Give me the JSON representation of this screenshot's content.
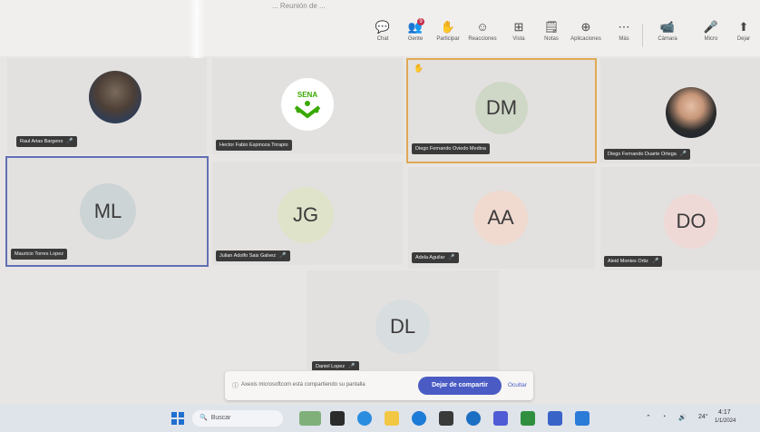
{
  "window": {
    "title_text": "... Reunión de ... "
  },
  "toolbar": {
    "items": [
      {
        "label": "Chat",
        "icon": "chat-icon",
        "glyph": "💬"
      },
      {
        "label": "Gente",
        "icon": "people-icon",
        "glyph": "👥",
        "badge": "9"
      },
      {
        "label": "Participar",
        "icon": "raise-hand-icon",
        "glyph": "✋"
      },
      {
        "label": "Reacciones",
        "icon": "smile-icon",
        "glyph": "☺"
      },
      {
        "label": "Vista",
        "icon": "grid-icon",
        "glyph": "⊞"
      },
      {
        "label": "Notas",
        "icon": "notes-icon",
        "glyph": "🗒"
      },
      {
        "label": "Aplicaciones",
        "icon": "apps-icon",
        "glyph": "⊕"
      },
      {
        "label": "Más",
        "icon": "more-icon",
        "glyph": "⋯"
      },
      {
        "label": "Cámara",
        "icon": "camera-icon",
        "glyph": "📹"
      },
      {
        "label": "Micro",
        "icon": "mic-icon",
        "glyph": "🎤"
      },
      {
        "label": "Dejar",
        "icon": "share-icon",
        "glyph": "⬆"
      }
    ]
  },
  "participants": [
    {
      "name": "Raul Arias Bargeno",
      "initials": "",
      "type": "photo"
    },
    {
      "name": "Hector Fabio Espinoza Tirrapio",
      "initials": "",
      "type": "logo",
      "logo_text": "SENA"
    },
    {
      "name": "Diego Fernando Oviedo Medina",
      "initials": "DM",
      "type": "initials",
      "raised_hand": true
    },
    {
      "name": "Diego Fernando Duarte Ortega",
      "initials": "",
      "type": "photo"
    },
    {
      "name": "Mauricio Torres Lopez",
      "initials": "ML",
      "type": "initials"
    },
    {
      "name": "Julian Adolfo Sais Galvez",
      "initials": "JG",
      "type": "initials"
    },
    {
      "name": "Adela Aguilar",
      "initials": "AA",
      "type": "initials"
    },
    {
      "name": "Aleid Montes Ortiz",
      "initials": "DO",
      "type": "initials"
    },
    {
      "name": "Daniel Lopez",
      "initials": "DL",
      "type": "initials"
    }
  ],
  "share_bar": {
    "message": "Axexis microsoftcom está compartiendo su pantalla",
    "stop_label": "Dejar de compartir",
    "hide_label": "Ocultar"
  },
  "taskbar": {
    "search_placeholder": "Buscar",
    "tray_temp": "24°",
    "tray_time": "4:17",
    "tray_date": "1/1/2024"
  },
  "colors": {
    "accent": "#4a5bc4",
    "active_border": "#e0a955",
    "pinned_border": "#6170b5"
  }
}
